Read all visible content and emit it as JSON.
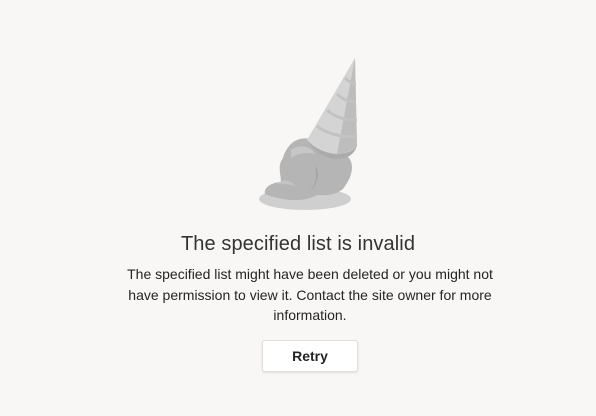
{
  "illustration": {
    "icon": "melted-ice-cream-cone-icon"
  },
  "error": {
    "title": "The specified list is invalid",
    "message": "The specified list might have been deleted or you might not have permission to view it. Contact the site owner for more information."
  },
  "actions": {
    "retry_label": "Retry"
  }
}
